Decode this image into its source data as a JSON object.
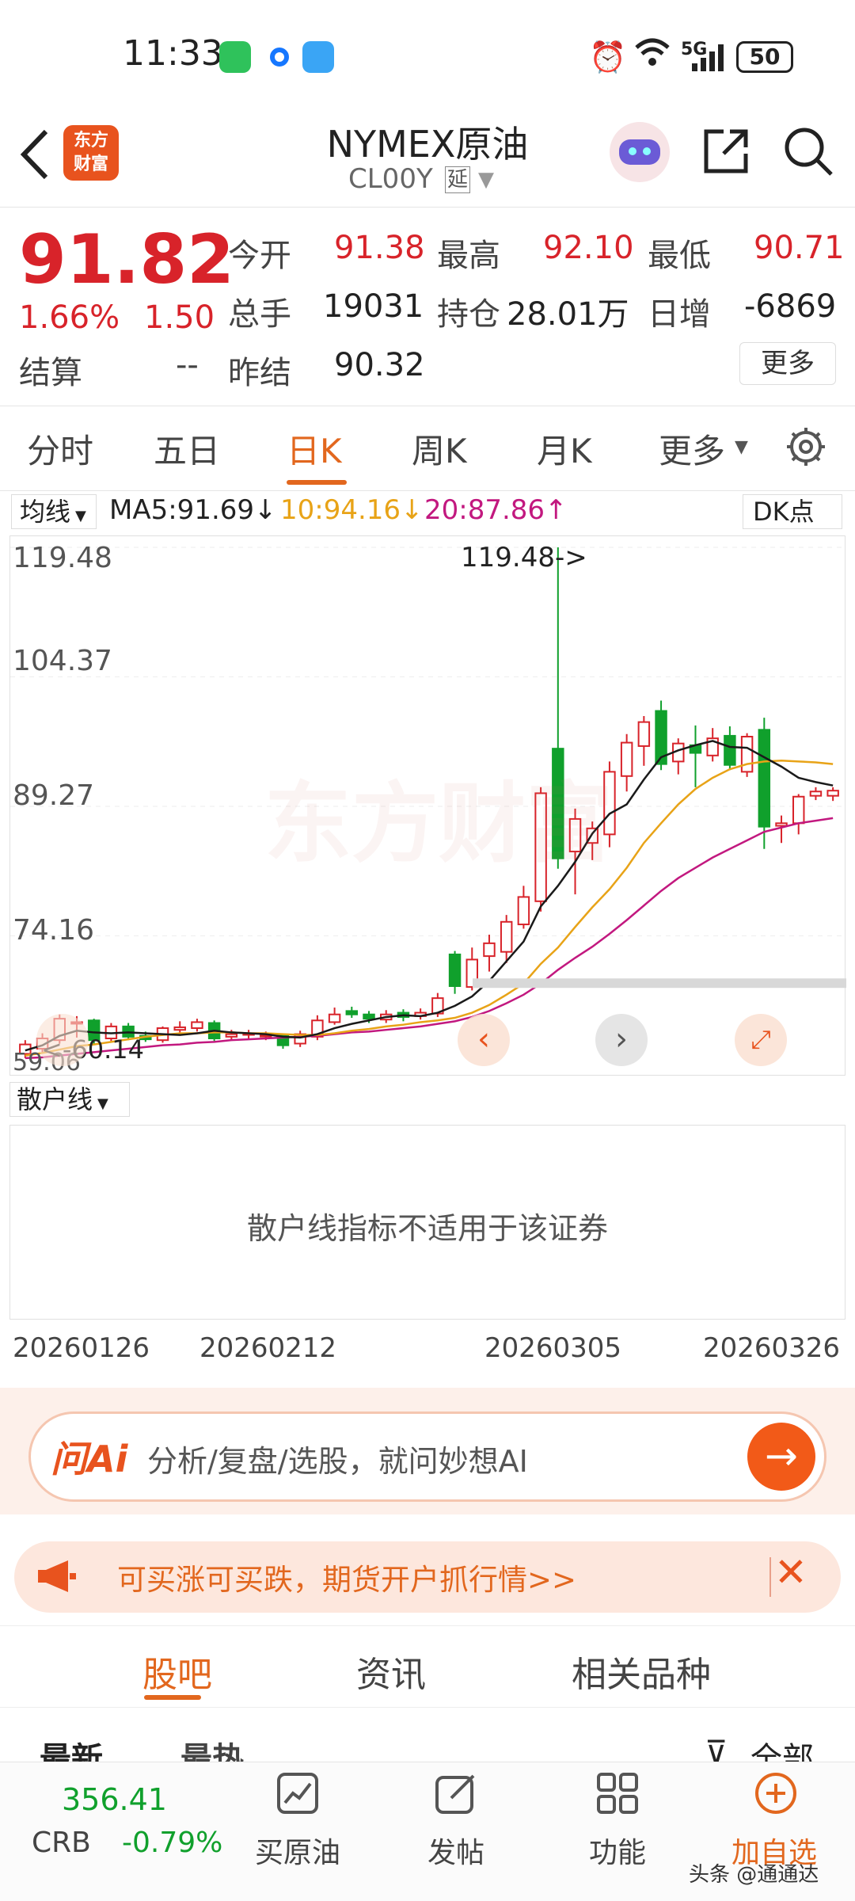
{
  "status_bar": {
    "time": "11:33",
    "network": "5G",
    "battery": "50",
    "icons": [
      "wechat-icon",
      "app-dot-icon",
      "search-app-icon",
      "alarm-icon",
      "wifi-icon",
      "signal-icon",
      "battery-icon"
    ]
  },
  "header": {
    "logo_text": "东方\n财富",
    "title": "NYMEX原油",
    "code": "CL00Y",
    "delay_badge": "延",
    "icons": [
      "back-icon",
      "robot-avatar-icon",
      "share-icon",
      "search-icon"
    ]
  },
  "quote": {
    "price": "91.82",
    "change_pct": "1.66%",
    "change": "1.50",
    "open_label": "今开",
    "open": "91.38",
    "high_label": "最高",
    "high": "92.10",
    "low_label": "最低",
    "low": "90.71",
    "volume_label": "总手",
    "volume": "19031",
    "oi_label": "持仓",
    "oi": "28.01万",
    "daily_inc_label": "日增",
    "daily_inc": "-6869",
    "settle_label": "结算",
    "settle": "--",
    "prev_settle_label": "昨结",
    "prev_settle": "90.32",
    "more_label": "更多"
  },
  "period_tabs": {
    "items": [
      "分时",
      "五日",
      "日K",
      "周K",
      "月K",
      "更多"
    ],
    "active": "日K",
    "settings_icon": "gear-icon"
  },
  "ma": {
    "selector": "均线",
    "ma5": "MA5:91.69",
    "ma5_arrow": "↓",
    "ma10": "10:94.16",
    "ma10_arrow": "↓",
    "ma20": "20:87.86",
    "ma20_arrow": "↑",
    "dk_label": "DK点"
  },
  "chart_data": {
    "type": "candlestick",
    "watermark": "东方财富",
    "y_ticks": [
      "119.48",
      "104.37",
      "89.27",
      "74.16"
    ],
    "y_bottom_label": "59.06",
    "max_annotation": "119.48->",
    "min_annotation": "<-60.14",
    "ylim": [
      59.06,
      119.48
    ],
    "x_tick_labels": [
      "20260126",
      "20260212",
      "20260305",
      "20260326"
    ],
    "colors": {
      "up": "#d8232a",
      "down": "#10a02c",
      "ma5": "#1a1a1a",
      "ma10": "#e8a317",
      "ma20": "#c2187f"
    },
    "candles": [
      {
        "o": 60.4,
        "c": 61.5,
        "h": 62.0,
        "l": 59.9
      },
      {
        "o": 61.0,
        "c": 62.2,
        "h": 62.8,
        "l": 60.5
      },
      {
        "o": 62.0,
        "c": 64.5,
        "h": 65.0,
        "l": 61.6
      },
      {
        "o": 64.0,
        "c": 64.1,
        "h": 64.8,
        "l": 62.3
      },
      {
        "o": 64.3,
        "c": 62.0,
        "h": 64.5,
        "l": 61.6
      },
      {
        "o": 62.2,
        "c": 63.6,
        "h": 64.0,
        "l": 61.9
      },
      {
        "o": 63.6,
        "c": 62.4,
        "h": 64.0,
        "l": 62.0
      },
      {
        "o": 62.5,
        "c": 62.1,
        "h": 63.0,
        "l": 61.8
      },
      {
        "o": 62.0,
        "c": 63.4,
        "h": 63.6,
        "l": 61.7
      },
      {
        "o": 63.2,
        "c": 63.5,
        "h": 64.2,
        "l": 62.7
      },
      {
        "o": 63.4,
        "c": 64.1,
        "h": 64.5,
        "l": 63.0
      },
      {
        "o": 64.0,
        "c": 62.2,
        "h": 64.3,
        "l": 61.9
      },
      {
        "o": 62.4,
        "c": 62.7,
        "h": 63.2,
        "l": 62.0
      },
      {
        "o": 62.7,
        "c": 62.8,
        "h": 63.2,
        "l": 62.2
      },
      {
        "o": 62.5,
        "c": 62.6,
        "h": 63.0,
        "l": 62.0
      },
      {
        "o": 62.6,
        "c": 61.4,
        "h": 62.8,
        "l": 61.0
      },
      {
        "o": 61.6,
        "c": 62.7,
        "h": 63.1,
        "l": 61.2
      },
      {
        "o": 62.4,
        "c": 64.3,
        "h": 64.9,
        "l": 62.0
      },
      {
        "o": 64.1,
        "c": 65.0,
        "h": 65.8,
        "l": 63.8
      },
      {
        "o": 65.4,
        "c": 65.0,
        "h": 65.9,
        "l": 64.6
      },
      {
        "o": 65.0,
        "c": 64.5,
        "h": 65.4,
        "l": 64.0
      },
      {
        "o": 64.4,
        "c": 65.0,
        "h": 65.5,
        "l": 64.0
      },
      {
        "o": 65.2,
        "c": 64.7,
        "h": 65.6,
        "l": 64.2
      },
      {
        "o": 64.8,
        "c": 65.2,
        "h": 65.7,
        "l": 64.4
      },
      {
        "o": 65.1,
        "c": 66.9,
        "h": 67.5,
        "l": 64.7
      },
      {
        "o": 72.0,
        "c": 68.3,
        "h": 72.4,
        "l": 67.4
      },
      {
        "o": 68.2,
        "c": 71.4,
        "h": 72.8,
        "l": 67.8
      },
      {
        "o": 71.8,
        "c": 73.3,
        "h": 74.3,
        "l": 70.0
      },
      {
        "o": 72.3,
        "c": 75.8,
        "h": 76.6,
        "l": 71.0
      },
      {
        "o": 75.5,
        "c": 78.7,
        "h": 80.0,
        "l": 75.0
      },
      {
        "o": 78.2,
        "c": 90.8,
        "h": 91.5,
        "l": 77.0
      },
      {
        "o": 96.0,
        "c": 83.2,
        "h": 119.48,
        "l": 82.0
      },
      {
        "o": 84.0,
        "c": 87.8,
        "h": 89.0,
        "l": 79.0
      },
      {
        "o": 85.0,
        "c": 86.7,
        "h": 87.5,
        "l": 83.0
      },
      {
        "o": 86.0,
        "c": 93.3,
        "h": 94.5,
        "l": 84.5
      },
      {
        "o": 92.8,
        "c": 96.7,
        "h": 97.7,
        "l": 91.0
      },
      {
        "o": 96.3,
        "c": 99.1,
        "h": 99.8,
        "l": 94.0
      },
      {
        "o": 100.4,
        "c": 94.2,
        "h": 101.6,
        "l": 93.5
      },
      {
        "o": 94.5,
        "c": 96.6,
        "h": 97.2,
        "l": 93.0
      },
      {
        "o": 96.4,
        "c": 95.5,
        "h": 98.7,
        "l": 91.5
      },
      {
        "o": 95.2,
        "c": 97.2,
        "h": 98.4,
        "l": 94.5
      },
      {
        "o": 97.5,
        "c": 94.1,
        "h": 98.6,
        "l": 93.5
      },
      {
        "o": 93.3,
        "c": 97.4,
        "h": 97.8,
        "l": 92.7
      },
      {
        "o": 98.2,
        "c": 86.9,
        "h": 99.6,
        "l": 84.3
      },
      {
        "o": 87.0,
        "c": 87.3,
        "h": 88.2,
        "l": 85.0
      },
      {
        "o": 87.3,
        "c": 90.4,
        "h": 90.7,
        "l": 86.0
      },
      {
        "o": 90.5,
        "c": 91.0,
        "h": 91.5,
        "l": 90.0
      },
      {
        "o": 90.5,
        "c": 91.1,
        "h": 91.5,
        "l": 89.9
      }
    ],
    "ma5": [
      60.8,
      61.4,
      62.5,
      63.1,
      62.9,
      62.8,
      62.9,
      62.8,
      62.7,
      62.6,
      62.8,
      63.1,
      62.9,
      62.8,
      62.7,
      62.4,
      62.3,
      62.7,
      63.4,
      63.9,
      64.3,
      64.7,
      64.9,
      64.8,
      65.2,
      66.0,
      67.1,
      68.9,
      71.2,
      73.5,
      77.6,
      80.0,
      82.8,
      86.1,
      88.4,
      89.5,
      92.4,
      95.0,
      95.8,
      96.4,
      96.9,
      96.2,
      96.1,
      95.0,
      93.9,
      92.6,
      92.1,
      91.7
    ],
    "ma10": [
      60.2,
      60.5,
      60.9,
      61.3,
      61.5,
      61.8,
      62.1,
      62.4,
      62.6,
      62.8,
      62.8,
      62.9,
      62.9,
      62.8,
      62.8,
      62.7,
      62.6,
      62.6,
      62.8,
      63.1,
      63.3,
      63.6,
      63.8,
      64.1,
      64.3,
      64.6,
      65.2,
      66.1,
      67.3,
      68.6,
      70.9,
      72.8,
      75.2,
      77.5,
      79.6,
      82.1,
      85.0,
      87.3,
      89.5,
      91.3,
      92.6,
      93.6,
      94.2,
      94.5,
      94.6,
      94.5,
      94.4,
      94.2
    ],
    "ma20": [
      59.9,
      60.0,
      60.2,
      60.4,
      60.6,
      60.8,
      61.0,
      61.2,
      61.4,
      61.5,
      61.7,
      61.8,
      62.0,
      62.1,
      62.2,
      62.3,
      62.4,
      62.5,
      62.7,
      62.9,
      63.0,
      63.2,
      63.4,
      63.6,
      63.9,
      64.2,
      64.7,
      65.4,
      66.3,
      67.3,
      68.6,
      70.2,
      71.6,
      72.9,
      74.4,
      76.0,
      77.7,
      79.4,
      80.9,
      82.1,
      83.3,
      84.3,
      85.3,
      86.3,
      86.8,
      87.3,
      87.6,
      87.9
    ]
  },
  "indicator": {
    "selector": "散户线",
    "message": "散户线指标不适用于该证券"
  },
  "ai_search": {
    "logo": "问Ai",
    "placeholder": "分析/复盘/选股，就问妙想AI"
  },
  "promo": {
    "text": "可买涨可买跌，期货开户抓行情>>"
  },
  "content_tabs": {
    "items": [
      "股吧",
      "资讯",
      "相关品种"
    ],
    "active": "股吧",
    "sub_items": [
      "最新",
      "最热",
      "全部"
    ]
  },
  "bottom_bar": {
    "index_value": "356.41",
    "index_name": "CRB",
    "index_change": "-0.79%",
    "items": [
      "买原油",
      "发帖",
      "功能",
      "加自选"
    ],
    "watermark": "头条 @通通达"
  }
}
